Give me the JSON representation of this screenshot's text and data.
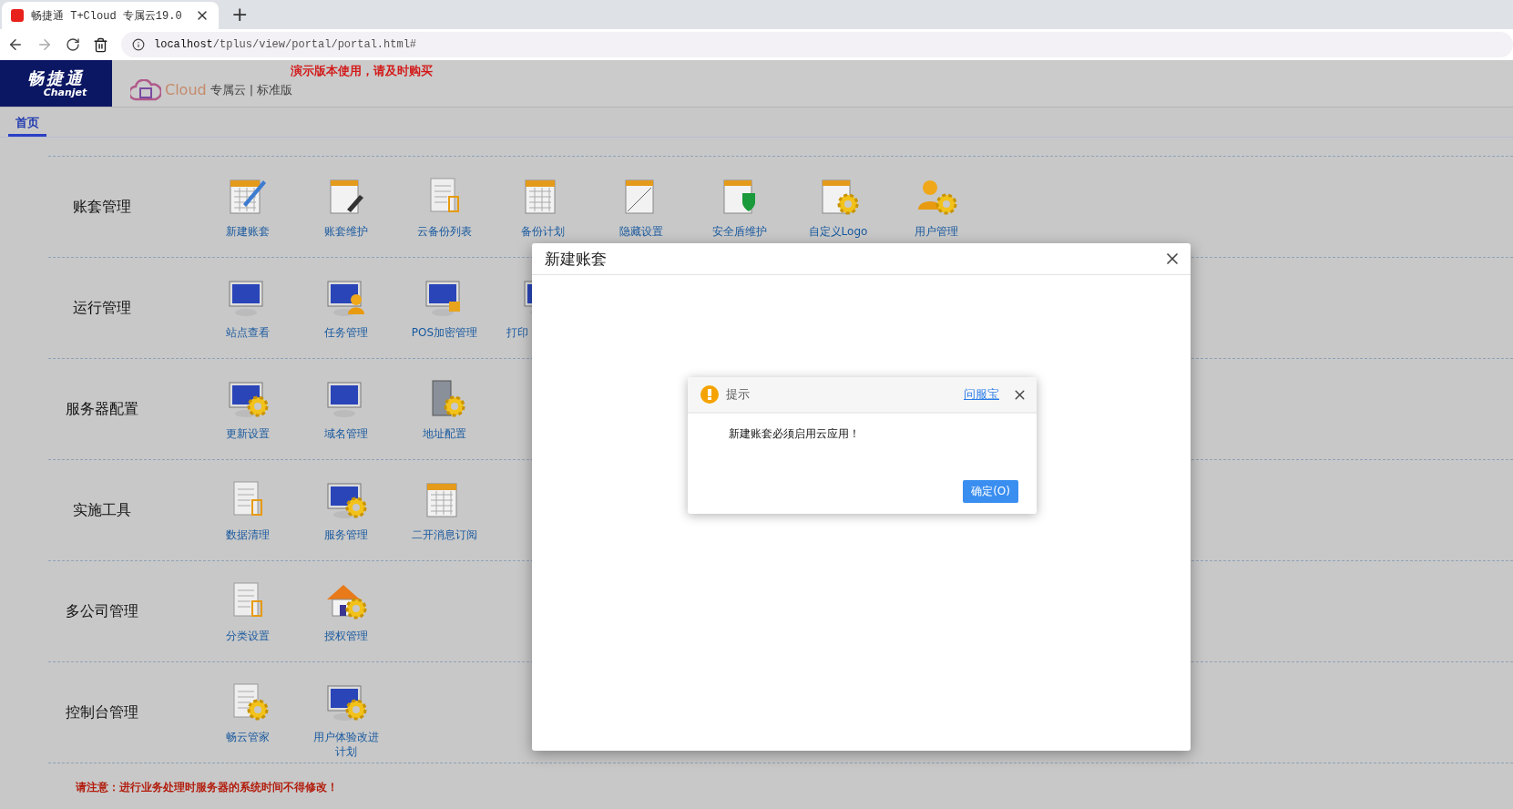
{
  "browser": {
    "tab_title": "畅捷通 T+Cloud 专属云19.0",
    "new_tab": "+",
    "url_host": "localhost",
    "url_path": "/tplus/view/portal/portal.html#"
  },
  "header": {
    "logo_text": "畅捷通",
    "logo_sub": "Chanjet",
    "product": "Cloud",
    "edition": "专属云",
    "separator": "|",
    "variant": "标准版",
    "notice": "演示版本使用，请及时购买"
  },
  "tabs": [
    {
      "label": "首页",
      "selected": true
    }
  ],
  "sections": [
    {
      "title": "账套管理",
      "items": [
        "新建账套",
        "账套维护",
        "云备份列表",
        "备份计划",
        "隐藏设置",
        "安全盾维护",
        "自定义Logo",
        "用户管理"
      ]
    },
    {
      "title": "运行管理",
      "items": [
        "站点查看",
        "任务管理",
        "POS加密管理",
        {
          "label": "打印",
          "cut_off": true
        }
      ]
    },
    {
      "title": "服务器配置",
      "items": [
        "更新设置",
        "域名管理",
        "地址配置"
      ]
    },
    {
      "title": "实施工具",
      "items": [
        "数据清理",
        "服务管理",
        "二开消息订阅"
      ]
    },
    {
      "title": "多公司管理",
      "items": [
        "分类设置",
        "授权管理"
      ]
    },
    {
      "title": "控制台管理",
      "items": [
        "畅云管家",
        "用户体验改进计划"
      ]
    }
  ],
  "footer_note": "请注意：进行业务处理时服务器的系统时间不得修改！",
  "dialog": {
    "title": "新建账套",
    "alert": {
      "title": "提示",
      "help_link": "问服宝",
      "message": "新建账套必须启用云应用！",
      "button": "确定(O)"
    }
  }
}
